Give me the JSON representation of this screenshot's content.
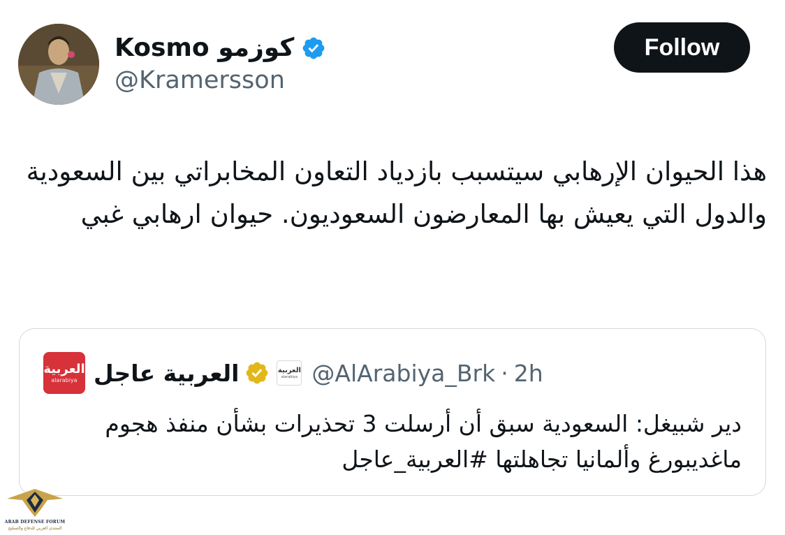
{
  "author": {
    "display_name": "Kosmo كوزمو",
    "handle": "@Kramersson",
    "verified": true
  },
  "follow_button": {
    "label": "Follow"
  },
  "tweet": {
    "text": "هذا الحيوان الإرهابي سيتسبب بازدياد التعاون المخابراتي بين السعودية والدول التي يعيش بها المعارضون السعوديون. حيوان ارهابي غبي"
  },
  "quoted": {
    "logo_text": "العربية",
    "logo_sub": "alarabiya",
    "display_name": "العربية عاجل",
    "handle": "@AlArabiya_Brk",
    "separator": "·",
    "time": "2h",
    "text": "دير شبيغل: السعودية سبق أن أرسلت 3 تحذيرات بشأن منفذ هجوم ماغديبورغ وألمانيا تجاهلتها #العربية_عاجل"
  },
  "watermark": {
    "title": "ARAB DEFENSE FORUM",
    "subtitle": "المنتدى العربي للدفاع والتسليح"
  },
  "colors": {
    "verified_blue": "#1d9bf0",
    "gold_badge": "#e2b719",
    "brand_red": "#d7313a",
    "button_bg": "#0f1419",
    "secondary_text": "#536471",
    "border": "#cfd9de"
  }
}
